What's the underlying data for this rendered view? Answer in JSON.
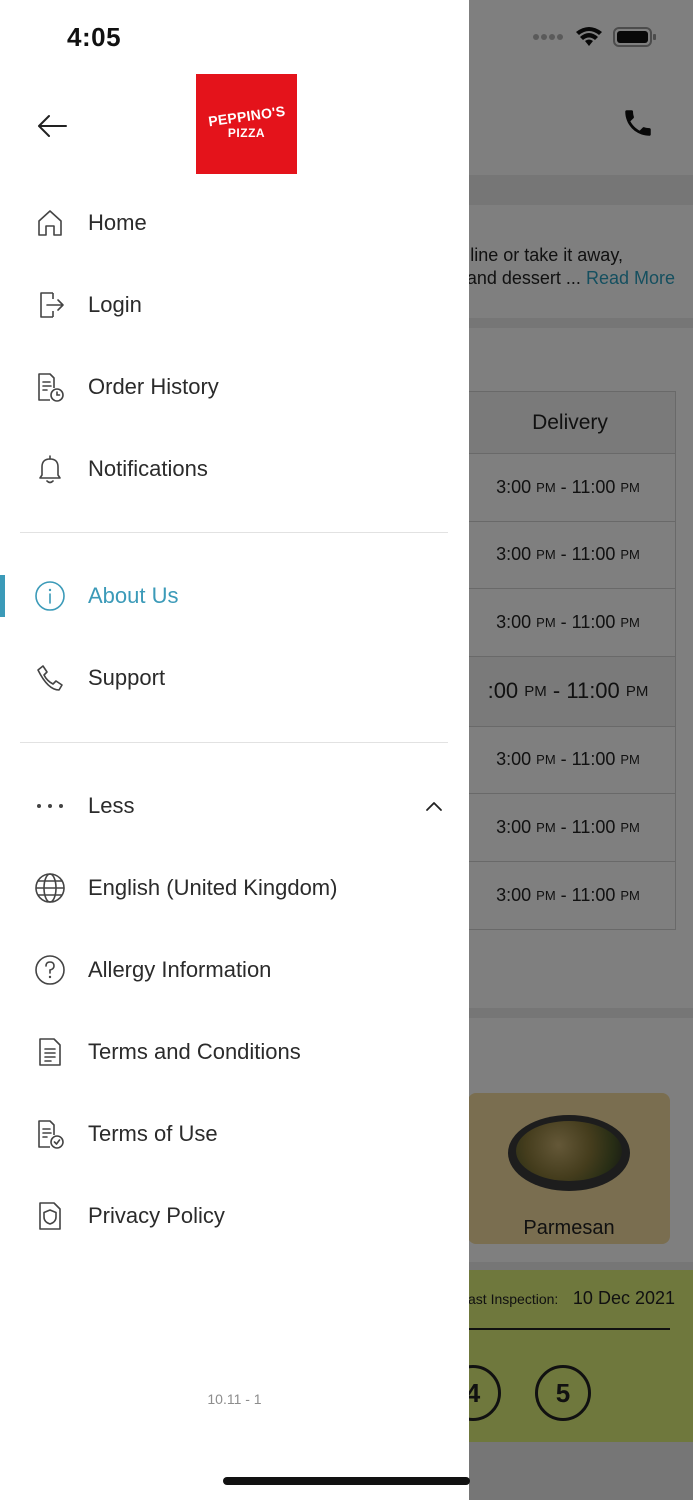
{
  "status_bar": {
    "time": "4:05"
  },
  "background_page": {
    "about_text_line1": "line or take it away,",
    "about_text_line2": "and dessert ...",
    "read_more": "Read More",
    "hours_header": "Delivery",
    "hours": [
      {
        "from": "3:00",
        "from_ampm": "PM",
        "to": "11:00",
        "to_ampm": "PM"
      },
      {
        "from": "3:00",
        "from_ampm": "PM",
        "to": "11:00",
        "to_ampm": "PM"
      },
      {
        "from": "3:00",
        "from_ampm": "PM",
        "to": "11:00",
        "to_ampm": "PM"
      },
      {
        "from": ":00",
        "from_ampm": "PM",
        "to": "11:00",
        "to_ampm": "PM"
      },
      {
        "from": "3:00",
        "from_ampm": "PM",
        "to": "11:00",
        "to_ampm": "PM"
      },
      {
        "from": "3:00",
        "from_ampm": "PM",
        "to": "11:00",
        "to_ampm": "PM"
      },
      {
        "from": "3:00",
        "from_ampm": "PM",
        "to": "11:00",
        "to_ampm": "PM"
      }
    ],
    "food_label": "Parmesan",
    "inspection_label": "ast Inspection:",
    "inspection_date": "10 Dec 2021",
    "ratings": [
      "4",
      "5"
    ]
  },
  "drawer": {
    "logo_line1": "PEPPINO'S",
    "logo_line2": "PIZZA",
    "items": [
      {
        "label": "Home",
        "icon": "home-icon"
      },
      {
        "label": "Login",
        "icon": "login-icon"
      },
      {
        "label": "Order History",
        "icon": "order-history-icon"
      },
      {
        "label": "Notifications",
        "icon": "bell-icon"
      },
      {
        "label": "About Us",
        "icon": "info-icon",
        "active": true
      },
      {
        "label": "Support",
        "icon": "phone-icon"
      },
      {
        "label": "Less",
        "icon": "more-dots-icon"
      },
      {
        "label": "English (United Kingdom)",
        "icon": "globe-icon"
      },
      {
        "label": "Allergy Information",
        "icon": "question-icon"
      },
      {
        "label": "Terms and Conditions",
        "icon": "document-icon"
      },
      {
        "label": "Terms of Use",
        "icon": "document-check-icon"
      },
      {
        "label": "Privacy Policy",
        "icon": "shield-document-icon"
      }
    ],
    "version": "10.11 - 1"
  },
  "colors": {
    "accent": "#3b9ab8",
    "brand": "#e4131b",
    "hygiene": "#dff07a"
  }
}
